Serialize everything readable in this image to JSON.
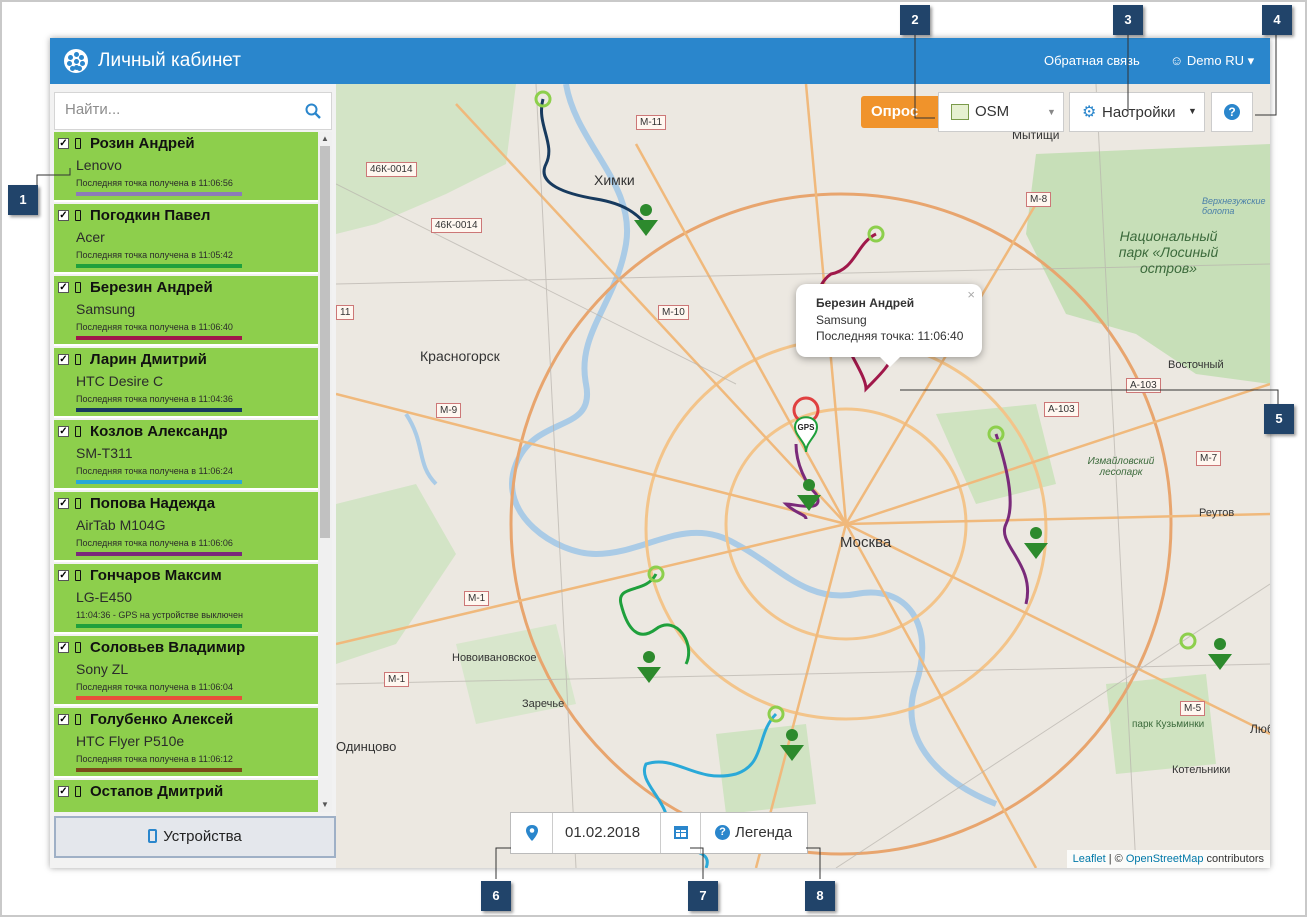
{
  "app": {
    "title": "Личный кабинет",
    "feedback": "Обратная связь",
    "user": "Demo RU"
  },
  "search": {
    "placeholder": "Найти..."
  },
  "devices": [
    {
      "name": "Розин Андрей",
      "model": "Lenovo",
      "status": "Последняя точка получена в 11:06:56",
      "color": "#8c7bb8"
    },
    {
      "name": "Погодкин Павел",
      "model": "Acer",
      "status": "Последняя точка получена в 11:05:42",
      "color": "#1fa03c"
    },
    {
      "name": "Березин Андрей",
      "model": "Samsung",
      "status": "Последняя точка получена в 11:06:40",
      "color": "#a0184a"
    },
    {
      "name": "Ларин Дмитрий",
      "model": "HTC Desire C",
      "status": "Последняя точка получена в 11:04:36",
      "color": "#173a5e"
    },
    {
      "name": "Козлов Александр",
      "model": "SM-T311",
      "status": "Последняя точка получена в 11:06:24",
      "color": "#2aa9d8"
    },
    {
      "name": "Попова Надежда",
      "model": "AirTab M104G",
      "status": "Последняя точка получена в 11:06:06",
      "color": "#7a2a7a"
    },
    {
      "name": "Гончаров Максим",
      "model": "LG-E450",
      "status": "11:04:36 - GPS на устройстве выключен",
      "color": "#1fa03c"
    },
    {
      "name": "Соловьев Владимир",
      "model": "Sony ZL",
      "status": "Последняя точка получена в 11:06:04",
      "color": "#e8503a"
    },
    {
      "name": "Голубенко Алексей",
      "model": "HTC Flyer P510e",
      "status": "Последняя точка получена в 11:06:12",
      "color": "#7a4a1a"
    },
    {
      "name": "Остапов Дмитрий",
      "model": "",
      "status": "",
      "color": "#8dcf4c"
    }
  ],
  "devices_button": "Устройства",
  "map": {
    "poll_button": "Опрос",
    "layer": "OSM",
    "settings": "Настройки",
    "help_symbol": "?",
    "popup": {
      "name": "Березин Андрей",
      "model": "Samsung",
      "last_point": "Последняя точка: 11:06:40",
      "close": "×"
    },
    "date": "01.02.2018",
    "legend": "Легенда",
    "attribution_leaflet": "Leaflet",
    "attribution_sep": " | © ",
    "attribution_osm": "OpenStreetMap",
    "attribution_tail": " contributors",
    "labels": {
      "khimki": "Химки",
      "krasnogorsk": "Красногорск",
      "moscow": "Москва",
      "national_park": "Национальный парк «Лосиный остров»",
      "vostochny": "Восточный",
      "reutov": "Реутов",
      "izmailovsky": "Измайловский лесопарк",
      "novoivanovskoe": "Новоивановское",
      "zarechye": "Заречье",
      "odintsovo": "Одинцово",
      "kuzminki": "парк Кузьминки",
      "kotelniki": "Котельники",
      "lyub": "Люб",
      "verkhnyaya": "Верхнезужские болота",
      "mytischi": "Мытищи"
    },
    "roads": [
      "М-11",
      "46К-0014",
      "46К-0014",
      "М-10",
      "М-9",
      "М-1",
      "М-1",
      "М-8",
      "А-103",
      "А-103",
      "М-7",
      "М-5",
      "11"
    ]
  },
  "badges": [
    "1",
    "2",
    "3",
    "4",
    "5",
    "6",
    "7",
    "8"
  ],
  "colors": {
    "header": "#2a86cc",
    "device_bg": "#8dcf4c",
    "poll": "#f0932b",
    "badge": "#21446a"
  }
}
